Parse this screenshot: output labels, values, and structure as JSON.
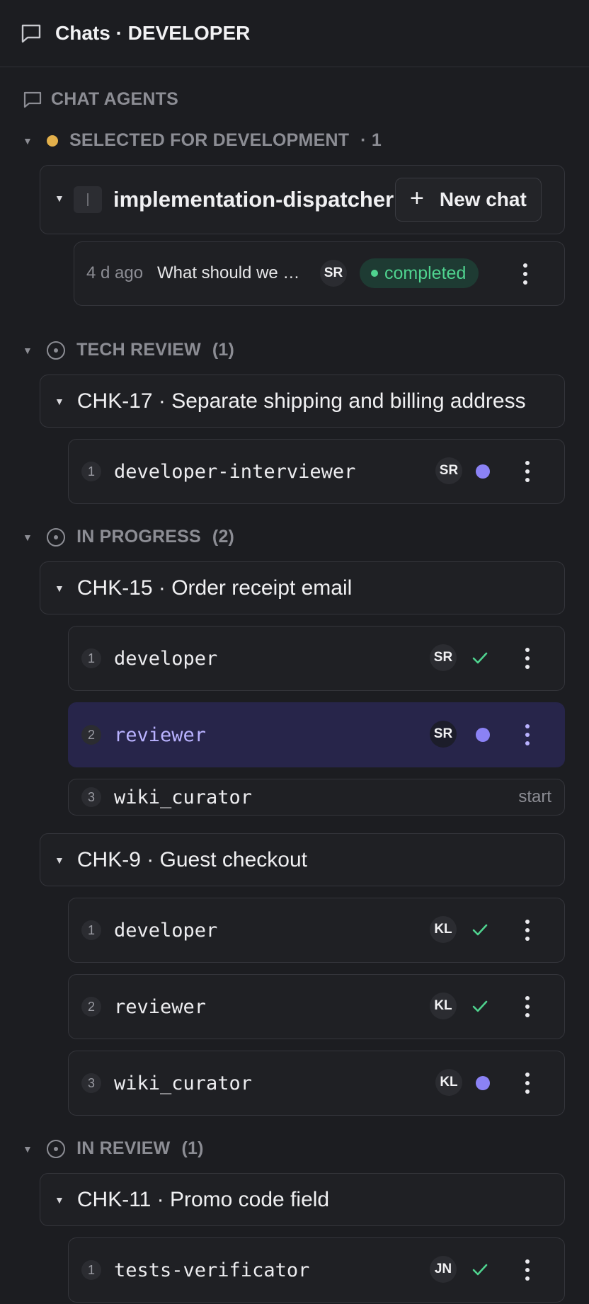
{
  "header": {
    "title": "Chats · DEVELOPER"
  },
  "panel": {
    "label": "CHAT AGENTS"
  },
  "selected": {
    "label": "SELECTED FOR DEVELOPMENT",
    "count": "· 1",
    "card_title": "implementation-dispatcher",
    "new_chat_label": "New chat",
    "chat": {
      "time": "4 d ago",
      "preview": "What should we …",
      "avatar": "SR",
      "status": "completed"
    }
  },
  "sections": [
    {
      "label": "TECH REVIEW",
      "count": "(1)",
      "items": [
        {
          "title": "CHK-17 · Separate shipping and billing address",
          "agents": [
            {
              "num": "1",
              "name": "developer-interviewer",
              "avatar": "SR",
              "state": "running"
            }
          ]
        }
      ]
    },
    {
      "label": "IN PROGRESS",
      "count": "(2)",
      "items": [
        {
          "title": "CHK-15 · Order receipt email",
          "agents": [
            {
              "num": "1",
              "name": "developer",
              "avatar": "SR",
              "state": "done"
            },
            {
              "num": "2",
              "name": "reviewer",
              "avatar": "SR",
              "state": "running"
            },
            {
              "num": "3",
              "name": "wiki_curator",
              "action": "start"
            }
          ]
        },
        {
          "title": "CHK-9 · Guest checkout",
          "agents": [
            {
              "num": "1",
              "name": "developer",
              "avatar": "KL",
              "state": "done"
            },
            {
              "num": "2",
              "name": "reviewer",
              "avatar": "KL",
              "state": "done"
            },
            {
              "num": "3",
              "name": "wiki_curator",
              "avatar": "KL",
              "state": "running"
            }
          ]
        }
      ]
    },
    {
      "label": "IN REVIEW",
      "count": "(1)",
      "items": [
        {
          "title": "CHK-11 · Promo code field",
          "agents": [
            {
              "num": "1",
              "name": "tests-verificator",
              "avatar": "JN",
              "state": "done"
            }
          ]
        }
      ]
    }
  ],
  "colors": {
    "accent": "#8b82f5",
    "success": "#4fd38f",
    "warning": "#e3b04b",
    "active_row": "#27254a"
  }
}
